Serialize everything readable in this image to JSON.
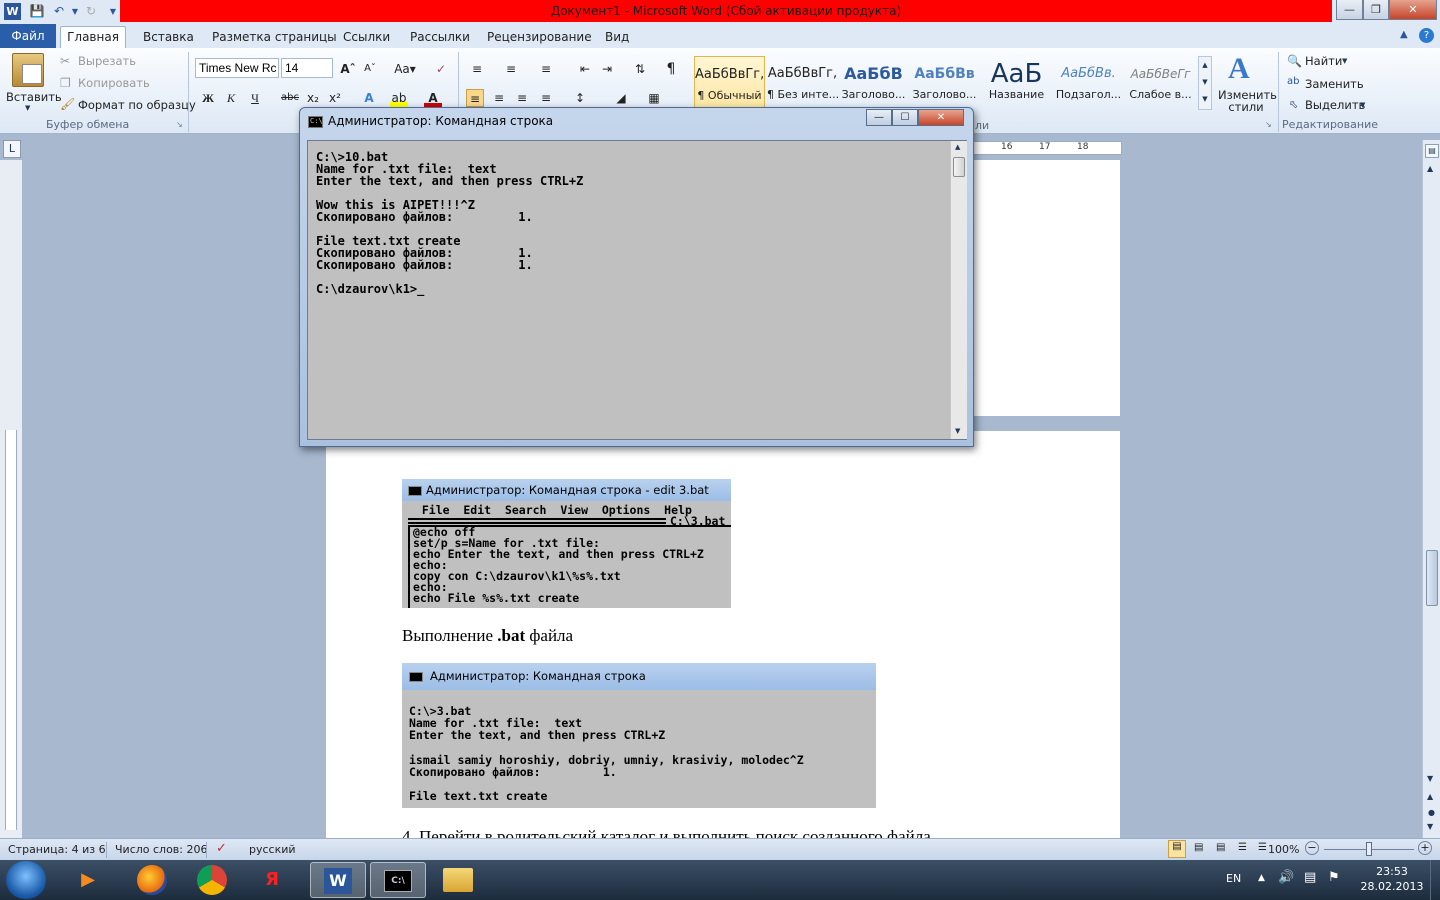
{
  "window": {
    "title": "Документ1  -  Microsoft Word (Сбой активации продукта)"
  },
  "tabs": {
    "file": "Файл",
    "items": [
      "Главная",
      "Вставка",
      "Разметка страницы",
      "Ссылки",
      "Рассылки",
      "Рецензирование",
      "Вид"
    ]
  },
  "clipboard": {
    "paste": "Вставить",
    "cut": "Вырезать",
    "copy": "Копировать",
    "format_painter": "Формат по образцу",
    "group": "Буфер обмена"
  },
  "font": {
    "name": "Times New Rc",
    "size": "14"
  },
  "styles": {
    "items": [
      {
        "preview": "АаБбВвГг,",
        "name": "¶ Обычный"
      },
      {
        "preview": "АаБбВвГг,",
        "name": "¶ Без инте..."
      },
      {
        "preview": "АаБбВ",
        "name": "Заголово..."
      },
      {
        "preview": "АаБбВв",
        "name": "Заголово..."
      },
      {
        "preview": "АаБ",
        "name": "Название"
      },
      {
        "preview": "АаБбВв.",
        "name": "Подзагол..."
      },
      {
        "preview": "АаБбВеГг",
        "name": "Слабое в..."
      }
    ],
    "change_styles": "Изменить стили",
    "group_tail": "ли"
  },
  "editing": {
    "find": "Найти",
    "replace": "Заменить",
    "select": "Выделить",
    "group": "Редактирование"
  },
  "ruler": {
    "marks": [
      "16",
      "17",
      "18"
    ]
  },
  "cmd": {
    "title": "Администратор: Командная строка",
    "lines": "C:\\>10.bat\nName for .txt file:  text\nEnter the text, and then press CTRL+Z\n\nWow this is AIPET!!!^Z\nСкопировано файлов:         1.\n\nFile text.txt create\nСкопировано файлов:         1.\nСкопировано файлов:         1.\n\nC:\\dzaurov\\k1>_"
  },
  "shot1": {
    "title": "Администратор: Командная строка - edit  3.bat",
    "menu": "  File  Edit  Search  View  Options  Help",
    "path": "C:\\3.bat",
    "lines": "@echo off\nset/p s=Name for .txt file:\necho Enter the text, and then press CTRL+Z\necho:\ncopy con C:\\dzaurov\\k1\\%s%.txt\necho:\necho File %s%.txt create"
  },
  "doc": {
    "caption_prefix": "Выполнение ",
    "caption_bold": ".bat",
    "caption_suffix": " файла",
    "next_line": "4. Перейти в родительский каталог и выполнить поиск созданного файла"
  },
  "shot2": {
    "title": "Администратор: Командная строка",
    "lines": "C:\\>3.bat\nName for .txt file:  text\nEnter the text, and then press CTRL+Z\n\nismail samiy horoshiy, dobriy, umniy, krasiviy, molodec^Z\nСкопировано файлов:         1.\n\nFile text.txt create"
  },
  "status": {
    "page": "Страница: 4 из 6",
    "words": "Число слов: 206",
    "language": "русский",
    "zoom": "100%"
  },
  "taskbar": {
    "lang": "EN",
    "time": "23:53",
    "date": "28.02.2013"
  }
}
